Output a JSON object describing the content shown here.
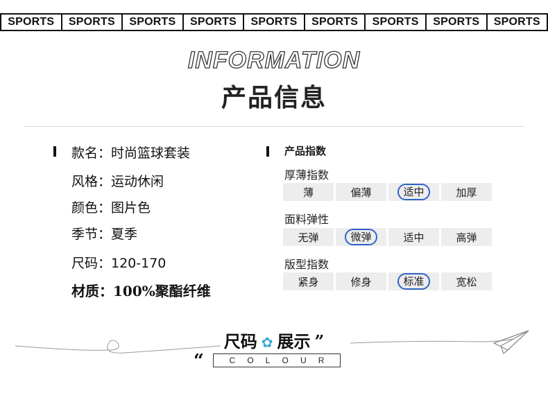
{
  "banner": {
    "items": [
      "SPORTS",
      "SPORTS",
      "SPORTS",
      "SPORTS",
      "SPORTS",
      "SPORTS",
      "SPORTS",
      "SPORTS",
      "SPORTS"
    ]
  },
  "header": {
    "title_en": "INFORMATION",
    "title_zh": "产品信息"
  },
  "product_info": {
    "rows": [
      "款名：时尚篮球套装",
      "风格：运动休闲",
      "颜色：图片色",
      "季节：夏季",
      "尺码：120-170",
      "材质：100%聚酯纤维"
    ]
  },
  "product_index": {
    "title": "产品指数",
    "groups": [
      {
        "label": "厚薄指数",
        "options": [
          "薄",
          "偏薄",
          "适中",
          "加厚"
        ],
        "selected": "适中"
      },
      {
        "label": "面料弹性",
        "options": [
          "无弹",
          "微弹",
          "适中",
          "高弹"
        ],
        "selected": "微弹"
      },
      {
        "label": "版型指数",
        "options": [
          "紧身",
          "修身",
          "标准",
          "宽松"
        ],
        "selected": "标准"
      }
    ],
    "highlight_color": "#2f63c8"
  },
  "size_section": {
    "title_left": "尺码",
    "title_right": "展示",
    "close_quote": "”",
    "open_quote": "“",
    "colour_letters": [
      "C",
      "O",
      "L",
      "O",
      "U",
      "R"
    ],
    "flower_icon": "flower-icon",
    "plane_icon": "paper-plane-icon"
  }
}
